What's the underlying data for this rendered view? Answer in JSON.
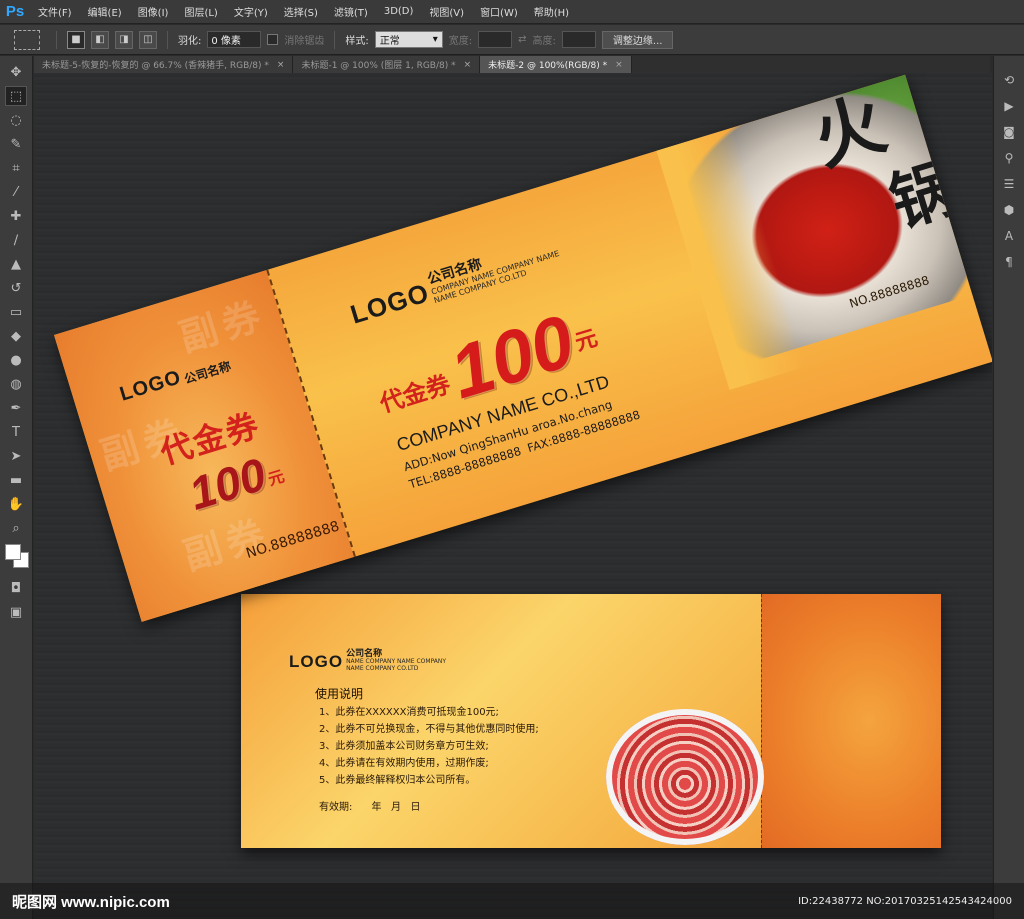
{
  "app": {
    "logo": "Ps"
  },
  "menu": [
    "文件(F)",
    "编辑(E)",
    "图像(I)",
    "图层(L)",
    "文字(Y)",
    "选择(S)",
    "滤镜(T)",
    "3D(D)",
    "视图(V)",
    "窗口(W)",
    "帮助(H)"
  ],
  "options": {
    "feather_label": "羽化:",
    "feather_value": "0 像素",
    "antialias_label": "消除锯齿",
    "style_label": "样式:",
    "style_value": "正常",
    "width_label": "宽度:",
    "height_label": "高度:",
    "refine_button": "调整边缘..."
  },
  "tabs": [
    {
      "label": "未标题-5-恢复的-恢复的 @ 66.7% (香辣猪手, RGB/8) *",
      "active": false
    },
    {
      "label": "未标题-1 @ 100% (图层 1, RGB/8) *",
      "active": false
    },
    {
      "label": "未标题-2 @ 100%(RGB/8) *",
      "active": true
    }
  ],
  "ticket_front": {
    "stub": {
      "logo": "LOGO",
      "company_cn": "公司名称",
      "voucher_cn": "代金券",
      "amount": "100",
      "unit": "元",
      "serial": "NO.88888888",
      "watermark": "副券"
    },
    "main": {
      "logo": "LOGO",
      "company_cn": "公司名称",
      "company_en_1": "COMPANY NAME COMPANY NAME",
      "company_en_2": "NAME COMPANY CO.LTD",
      "voucher_cn": "代金券",
      "amount": "100",
      "unit": "元",
      "serial": "NO.88888888",
      "company_name": "COMPANY NAME CO.,LTD",
      "address": "ADD:Now QingShanHu aroa.No.chang",
      "tel_fax": "TEL:8888-88888888  FAX:8888-88888888",
      "title_char_1": "火",
      "title_char_2": "锅"
    }
  },
  "ticket_back": {
    "logo": "LOGO",
    "company_cn": "公司名称",
    "company_en_1": "NAME COMPANY NAME COMPANY",
    "company_en_2": "NAME COMPANY CO.LTD",
    "rules_title": "使用说明",
    "rules": [
      "1、此券在XXXXXX消费可抵现金100元;",
      "2、此券不可兑换现金，不得与其他优惠同时使用;",
      "3、此券须加盖本公司财务章方可生效;",
      "4、此券请在有效期内使用，过期作废;",
      "5、此券最终解释权归本公司所有。"
    ],
    "validity": "有效期:      年   月   日"
  },
  "footer": {
    "site": "昵图网 www.nipic.com",
    "id": "ID:22438772 NO:20170325142543424000"
  }
}
